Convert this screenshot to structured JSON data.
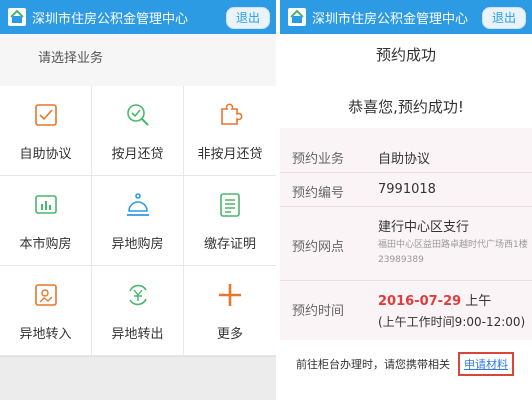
{
  "left": {
    "header": {
      "title": "深圳市住房公积金管理中心",
      "logout_label": "退出"
    },
    "section_title": "请选择业务",
    "services": [
      {
        "label": "自助协议",
        "icon": "checkbox-icon"
      },
      {
        "label": "按月还贷",
        "icon": "search-check-icon"
      },
      {
        "label": "非按月还贷",
        "icon": "puzzle-icon"
      },
      {
        "label": "本市购房",
        "icon": "chart-icon"
      },
      {
        "label": "异地购房",
        "icon": "bell-icon"
      },
      {
        "label": "缴存证明",
        "icon": "document-icon"
      },
      {
        "label": "异地转入",
        "icon": "image-icon"
      },
      {
        "label": "异地转出",
        "icon": "yuan-cycle-icon"
      },
      {
        "label": "更多",
        "icon": "plus-icon"
      }
    ]
  },
  "right": {
    "header": {
      "title": "深圳市住房公积金管理中心",
      "logout_label": "退出"
    },
    "title": "预约成功",
    "congrats": "恭喜您,预约成功!",
    "info": {
      "business_label": "预约业务",
      "business_value": "自助协议",
      "number_label": "预约编号",
      "number_value": "7991018",
      "branch_label": "预约网点",
      "branch_name": "建行中心区支行",
      "branch_address": "福田中心区益田路卓越时代广场西1楼",
      "branch_phone": "23989389",
      "time_label": "预约时间",
      "date": "2016-07-29",
      "period": "上午",
      "hours": "(上午工作时间9:00-12:00)"
    },
    "footer_note": "前往柜台办理时，请您携带相关",
    "materials_link": "申请材料"
  },
  "colors": {
    "header_blue": "#2d9be4",
    "accent_orange": "#e8762b",
    "icon_green": "#49b86a",
    "date_red": "#e23b3b"
  }
}
